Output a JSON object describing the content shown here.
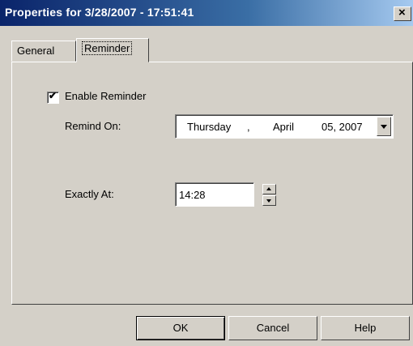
{
  "window": {
    "title": "Properties for  3/28/2007 - 17:51:41",
    "close_glyph": "×"
  },
  "tabs": [
    {
      "label": "General"
    },
    {
      "label": "Reminder"
    }
  ],
  "reminder": {
    "enable": {
      "checked": true,
      "label": "Enable Reminder"
    },
    "remind_on": {
      "label": "Remind On:",
      "weekday": "Thursday",
      "separator": ",",
      "month": "April",
      "day_year": "05, 2007"
    },
    "exactly_at": {
      "label": "Exactly At:",
      "value": "14:28"
    }
  },
  "buttons": {
    "ok": "OK",
    "cancel": "Cancel",
    "help": "Help"
  }
}
